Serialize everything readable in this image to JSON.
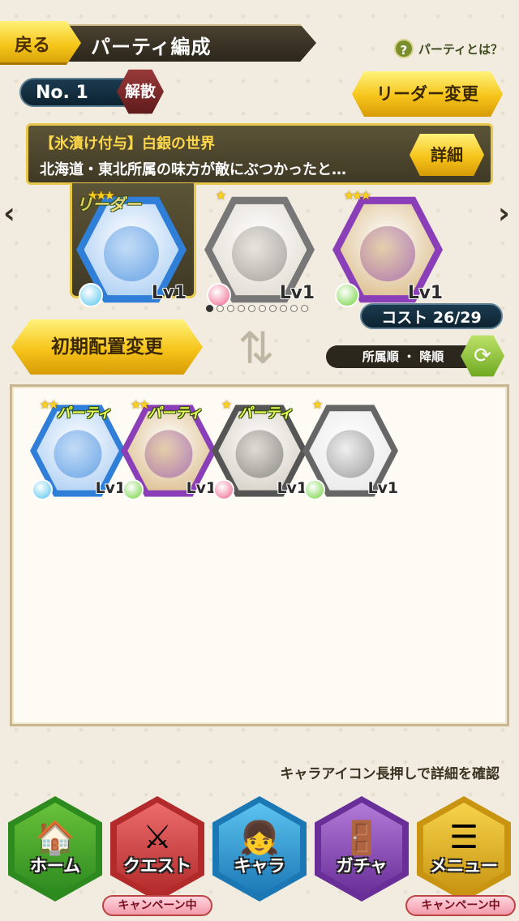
{
  "header": {
    "back_label": "戻る",
    "title": "パーティ編成",
    "help_label": "パーティとは？",
    "help_icon": "question-icon"
  },
  "party": {
    "number_label": "No. 1",
    "dissolve_label": "解散",
    "leader_change_label": "リーダー変更",
    "skill_name": "【氷漬け付与】白銀の世界",
    "skill_desc": "北海道・東北所属の味方が敵にぶつかったと…",
    "detail_label": "詳細",
    "leader_tag": "リーダー",
    "members": [
      {
        "name": "ice-girl",
        "stars": "★★★",
        "level": "Lv1",
        "frame": "#2f7fd9",
        "inner": "#9fc7f2",
        "element": "#4ec3ee"
      },
      {
        "name": "shiba-dog",
        "stars": "★",
        "level": "Lv1",
        "frame": "#777777",
        "inner": "#dcd6cb",
        "element": "#f0628a"
      },
      {
        "name": "samurai-girl",
        "stars": "★★★",
        "level": "Lv1",
        "frame": "#8a3fb8",
        "inner": "#d6b37a",
        "element": "#6fd13a"
      }
    ],
    "page_count": 10,
    "page_active": 0,
    "cost_label": "コスト 26/29"
  },
  "controls": {
    "initial_placement_label": "初期配置変更",
    "sort_label": "所属順 ・ 降順",
    "swap_icon": "swap-arrows-icon",
    "sort_toggle_icon": "refresh-icon"
  },
  "box": {
    "items": [
      {
        "name": "ice-girl",
        "stars": "★★",
        "tag": "パーティ",
        "level": "Lv1",
        "frame": "#2f7fd9",
        "inner": "#9fc7f2",
        "element": "#4ec3ee"
      },
      {
        "name": "samurai-girl",
        "stars": "★★",
        "tag": "パーティ",
        "level": "Lv1",
        "frame": "#8a3fb8",
        "inner": "#d6b37a",
        "element": "#6fd13a"
      },
      {
        "name": "shiba-dog",
        "stars": "★",
        "tag": "パーティ",
        "level": "Lv1",
        "frame": "#555555",
        "inner": "#cfc8bb",
        "element": "#f0628a"
      },
      {
        "name": "pink-blob",
        "stars": "★",
        "tag": "",
        "level": "Lv1",
        "frame": "#666666",
        "inner": "#e6e6e6",
        "element": "#6fd13a"
      }
    ]
  },
  "hint": "キャラアイコン長押しで詳細を確認",
  "nav": [
    {
      "label": "ホーム",
      "icon": "house-icon",
      "glyph": "🏠",
      "outer": "#2c8a1f",
      "inner": "#69c23a",
      "campaign": ""
    },
    {
      "label": "クエスト",
      "icon": "swords-icon",
      "glyph": "⚔",
      "outer": "#b22a2a",
      "inner": "#ec6c6c",
      "campaign": "キャンペーン中"
    },
    {
      "label": "キャラ",
      "icon": "character-icon",
      "glyph": "👧",
      "outer": "#1b78b5",
      "inner": "#5cc3ef",
      "campaign": ""
    },
    {
      "label": "ガチャ",
      "icon": "gacha-door-icon",
      "glyph": "🚪",
      "outer": "#6a2e98",
      "inner": "#b27ad8",
      "campaign": ""
    },
    {
      "label": "メニュー",
      "icon": "menu-icon",
      "glyph": "☰",
      "outer": "#c89411",
      "inner": "#f6d34a",
      "campaign": "キャンペーン中"
    }
  ]
}
